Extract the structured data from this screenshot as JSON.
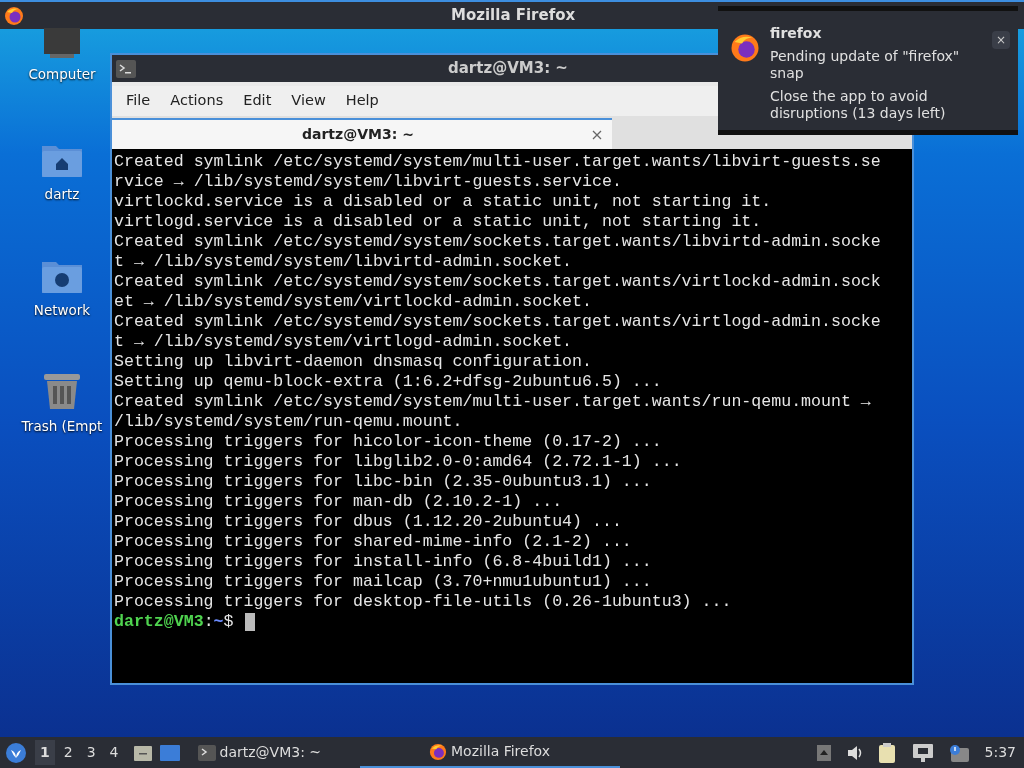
{
  "top_panel": {
    "title": "Mozilla Firefox"
  },
  "desktop_icons": [
    {
      "kind": "computer",
      "label": "Computer"
    },
    {
      "kind": "home",
      "label": "dartz"
    },
    {
      "kind": "network",
      "label": "Network"
    },
    {
      "kind": "trash",
      "label": "Trash (Empt"
    }
  ],
  "terminal": {
    "title": "dartz@VM3: ~",
    "menu": [
      "File",
      "Actions",
      "Edit",
      "View",
      "Help"
    ],
    "tabs": [
      {
        "label": "dartz@VM3: ~",
        "selected": true
      }
    ],
    "lines": [
      "Created symlink /etc/systemd/system/multi-user.target.wants/libvirt-guests.se",
      "rvice → /lib/systemd/system/libvirt-guests.service.",
      "virtlockd.service is a disabled or a static unit, not starting it.",
      "virtlogd.service is a disabled or a static unit, not starting it.",
      "Created symlink /etc/systemd/system/sockets.target.wants/libvirtd-admin.socke",
      "t → /lib/systemd/system/libvirtd-admin.socket.",
      "Created symlink /etc/systemd/system/sockets.target.wants/virtlockd-admin.sock",
      "et → /lib/systemd/system/virtlockd-admin.socket.",
      "Created symlink /etc/systemd/system/sockets.target.wants/virtlogd-admin.socke",
      "t → /lib/systemd/system/virtlogd-admin.socket.",
      "Setting up libvirt-daemon dnsmasq configuration.",
      "Setting up qemu-block-extra (1:6.2+dfsg-2ubuntu6.5) ...",
      "Created symlink /etc/systemd/system/multi-user.target.wants/run-qemu.mount →",
      "/lib/systemd/system/run-qemu.mount.",
      "Processing triggers for hicolor-icon-theme (0.17-2) ...",
      "Processing triggers for libglib2.0-0:amd64 (2.72.1-1) ...",
      "Processing triggers for libc-bin (2.35-0ubuntu3.1) ...",
      "Processing triggers for man-db (2.10.2-1) ...",
      "Processing triggers for dbus (1.12.20-2ubuntu4) ...",
      "Processing triggers for shared-mime-info (2.1-2) ...",
      "Processing triggers for install-info (6.8-4build1) ...",
      "Processing triggers for mailcap (3.70+nmu1ubuntu1) ...",
      "Processing triggers for desktop-file-utils (0.26-1ubuntu3) ..."
    ],
    "prompt": {
      "user_host": "dartz@VM3",
      "separator": ":",
      "path": "~",
      "symbol": "$"
    }
  },
  "notification": {
    "app": "firefox",
    "summary": "Pending update of \"firefox\" snap",
    "body": "Close the app to avoid disruptions (13 days left)",
    "close": "×"
  },
  "taskbar": {
    "workspaces": [
      {
        "label": "1",
        "selected": true
      },
      {
        "label": "2",
        "selected": false
      },
      {
        "label": "3",
        "selected": false
      },
      {
        "label": "4",
        "selected": false
      }
    ],
    "tasks": [
      {
        "kind": "terminal",
        "label": "dartz@VM3: ~",
        "selected": false
      },
      {
        "kind": "firefox",
        "label": "Mozilla Firefox",
        "selected": true
      }
    ],
    "clock": "5:37"
  }
}
